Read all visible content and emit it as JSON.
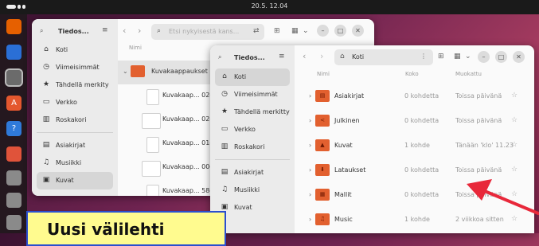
{
  "topbar": {
    "clock": "20.5.  12.04"
  },
  "dock": {
    "apps": [
      {
        "name": "firefox-icon",
        "glyph": "",
        "color": "#e66000"
      },
      {
        "name": "thunderbird-icon",
        "glyph": "",
        "color": "#2a6fd6"
      },
      {
        "name": "files-icon",
        "glyph": "",
        "color": "#6b6b6b"
      },
      {
        "name": "software-icon",
        "glyph": "A",
        "color": "#e4572e"
      },
      {
        "name": "help-icon",
        "glyph": "?",
        "color": "#2f7ad9"
      },
      {
        "name": "office-icon",
        "glyph": "",
        "color": "#e0533a"
      },
      {
        "name": "usb-drive-icon",
        "glyph": "",
        "color": "#8a8a8a"
      },
      {
        "name": "usb-drive-icon-2",
        "glyph": "",
        "color": "#8a8a8a"
      },
      {
        "name": "trash-icon",
        "glyph": "",
        "color": "#8a8a8a"
      }
    ]
  },
  "back_window": {
    "sidebar_title": "Tiedos...",
    "search_placeholder": "Etsi nykyisestä kans...",
    "column_name": "Nimi",
    "sidebar": [
      {
        "icon": "⌂",
        "label": "Koti",
        "name": "home"
      },
      {
        "icon": "◷",
        "label": "Viimeisimmät",
        "name": "recent"
      },
      {
        "icon": "★",
        "label": "Tähdellä merkity",
        "name": "starred"
      },
      {
        "icon": "▭",
        "label": "Verkko",
        "name": "network"
      },
      {
        "icon": "▥",
        "label": "Roskakori",
        "name": "trash"
      },
      {
        "icon": "▤",
        "label": "Asiakirjat",
        "name": "documents"
      },
      {
        "icon": "♫",
        "label": "Musiikki",
        "name": "music"
      },
      {
        "icon": "▣",
        "label": "Kuvat",
        "name": "pictures"
      }
    ],
    "folder_row": "Kuvakaappaukset",
    "files": [
      "Kuvakaap... 02-",
      "Kuvakaap... 02-",
      "Kuvakaap... 01-",
      "Kuvakaap... 00-",
      "Kuvakaap... 58-"
    ]
  },
  "front_window": {
    "sidebar_title": "Tiedos...",
    "path": "Koti",
    "columns": {
      "name": "Nimi",
      "size": "Koko",
      "modified": "Muokattu"
    },
    "sidebar": [
      {
        "icon": "⌂",
        "label": "Koti",
        "name": "home"
      },
      {
        "icon": "◷",
        "label": "Viimeisimmät",
        "name": "recent"
      },
      {
        "icon": "★",
        "label": "Tähdellä merkitty",
        "name": "starred"
      },
      {
        "icon": "▭",
        "label": "Verkko",
        "name": "network"
      },
      {
        "icon": "▥",
        "label": "Roskakori",
        "name": "trash"
      },
      {
        "icon": "▤",
        "label": "Asiakirjat",
        "name": "documents"
      },
      {
        "icon": "♫",
        "label": "Musiikki",
        "name": "music"
      },
      {
        "icon": "▣",
        "label": "Kuvat",
        "name": "pictures"
      }
    ],
    "rows": [
      {
        "name": "Asiakirjat",
        "size": "0 kohdetta",
        "modified": "Toissa päivänä",
        "icon": "▤"
      },
      {
        "name": "Julkinen",
        "size": "0 kohdetta",
        "modified": "Toissa päivänä",
        "icon": "<"
      },
      {
        "name": "Kuvat",
        "size": "1 kohde",
        "modified": "Tänään 'klo' 11.23",
        "icon": "▲"
      },
      {
        "name": "Lataukset",
        "size": "0 kohdetta",
        "modified": "Toissa päivänä",
        "icon": "⬇"
      },
      {
        "name": "Mallit",
        "size": "0 kohdetta",
        "modified": "Toissa päivänä",
        "icon": "▦"
      },
      {
        "name": "Music",
        "size": "1 kohde",
        "modified": "2 viikkoa sitten",
        "icon": "♫"
      }
    ]
  },
  "banner": {
    "text": "Uusi välilehti"
  },
  "colors": {
    "folder": "#e2602f",
    "folder_dark": "#b84222",
    "arrow": "#e8283a"
  }
}
